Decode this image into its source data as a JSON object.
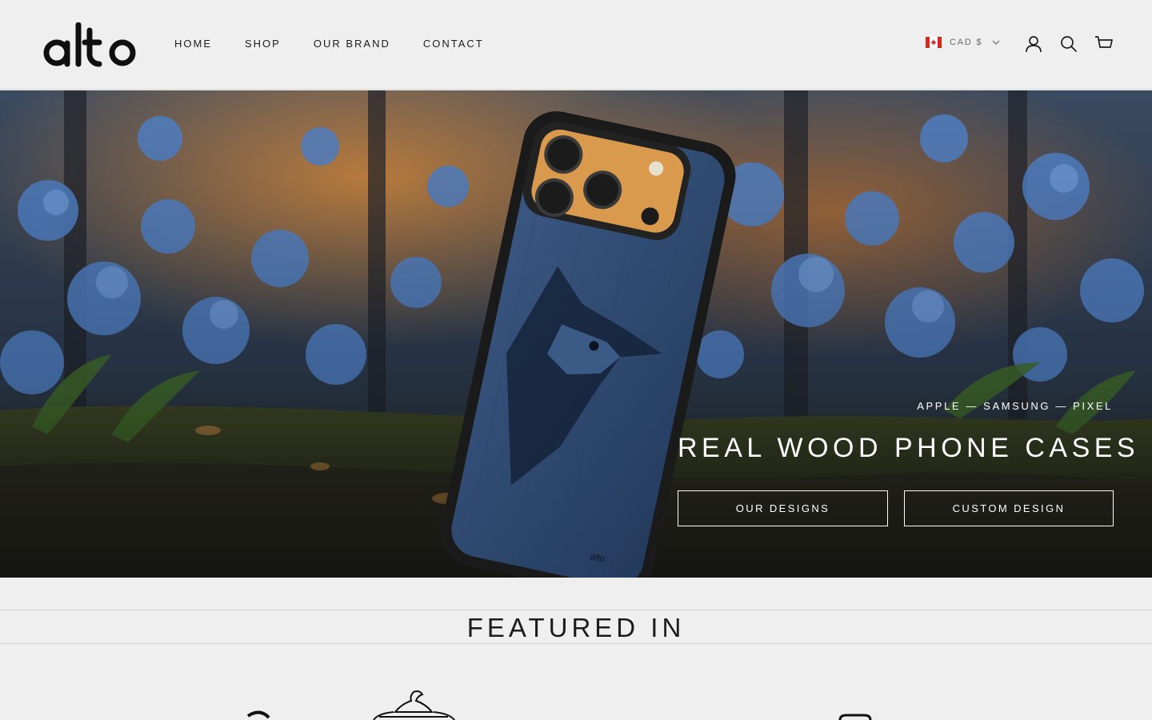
{
  "header": {
    "logo_text": "alto",
    "nav": [
      "HOME",
      "SHOP",
      "OUR BRAND",
      "CONTACT"
    ],
    "currency": "CAD $",
    "icons": [
      "account-icon",
      "search-icon",
      "cart-icon"
    ]
  },
  "hero": {
    "eyebrow": "APPLE — SAMSUNG — PIXEL",
    "title": "REAL WOOD PHONE CASES",
    "buttons": [
      "OUR DESIGNS",
      "CUSTOM DESIGN"
    ],
    "case_brand": "alto"
  },
  "featured": {
    "title": "FEATURED IN"
  },
  "colors": {
    "background": "#efefef",
    "text": "#1c1c1c",
    "canada_red": "#d52b1e",
    "hero_text": "#ffffff"
  }
}
